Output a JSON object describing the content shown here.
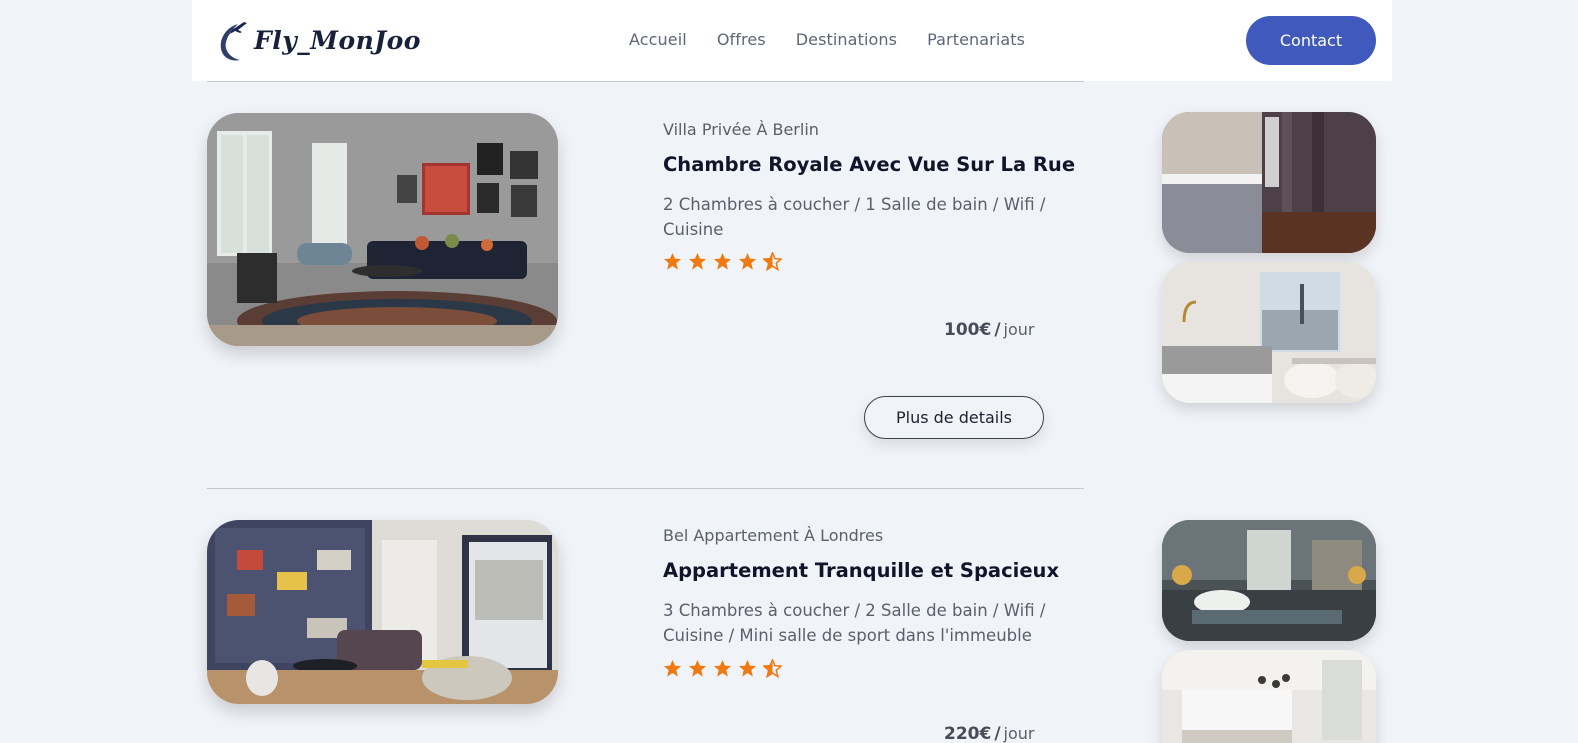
{
  "brand": {
    "name": "Fly_MonJoo",
    "logo_icon": "airplane-swoosh-icon"
  },
  "nav": {
    "items": [
      {
        "label": "Accueil"
      },
      {
        "label": "Offres"
      },
      {
        "label": "Destinations"
      },
      {
        "label": "Partenariats"
      }
    ],
    "contact_label": "Contact"
  },
  "colors": {
    "accent": "#4059bc",
    "star": "#f07a12",
    "background": "#f0f3f8"
  },
  "listings": [
    {
      "location": "Villa Privée À Berlin",
      "title": "Chambre Royale Avec Vue Sur La Rue",
      "features": "2 Chambres à coucher / 1 Salle de bain / Wifi / Cuisine",
      "rating": 4.5,
      "price": "100€",
      "price_sep": "/",
      "price_unit": "jour",
      "details_label": "Plus de details"
    },
    {
      "location": "Bel Appartement À Londres",
      "title": "Appartement Tranquille et Spacieux",
      "features": "3 Chambres à coucher / 2 Salle de bain / Wifi / Cuisine / Mini salle de sport dans l'immeuble",
      "rating": 4.5,
      "price": "220€",
      "price_sep": "/",
      "price_unit": "jour"
    }
  ]
}
